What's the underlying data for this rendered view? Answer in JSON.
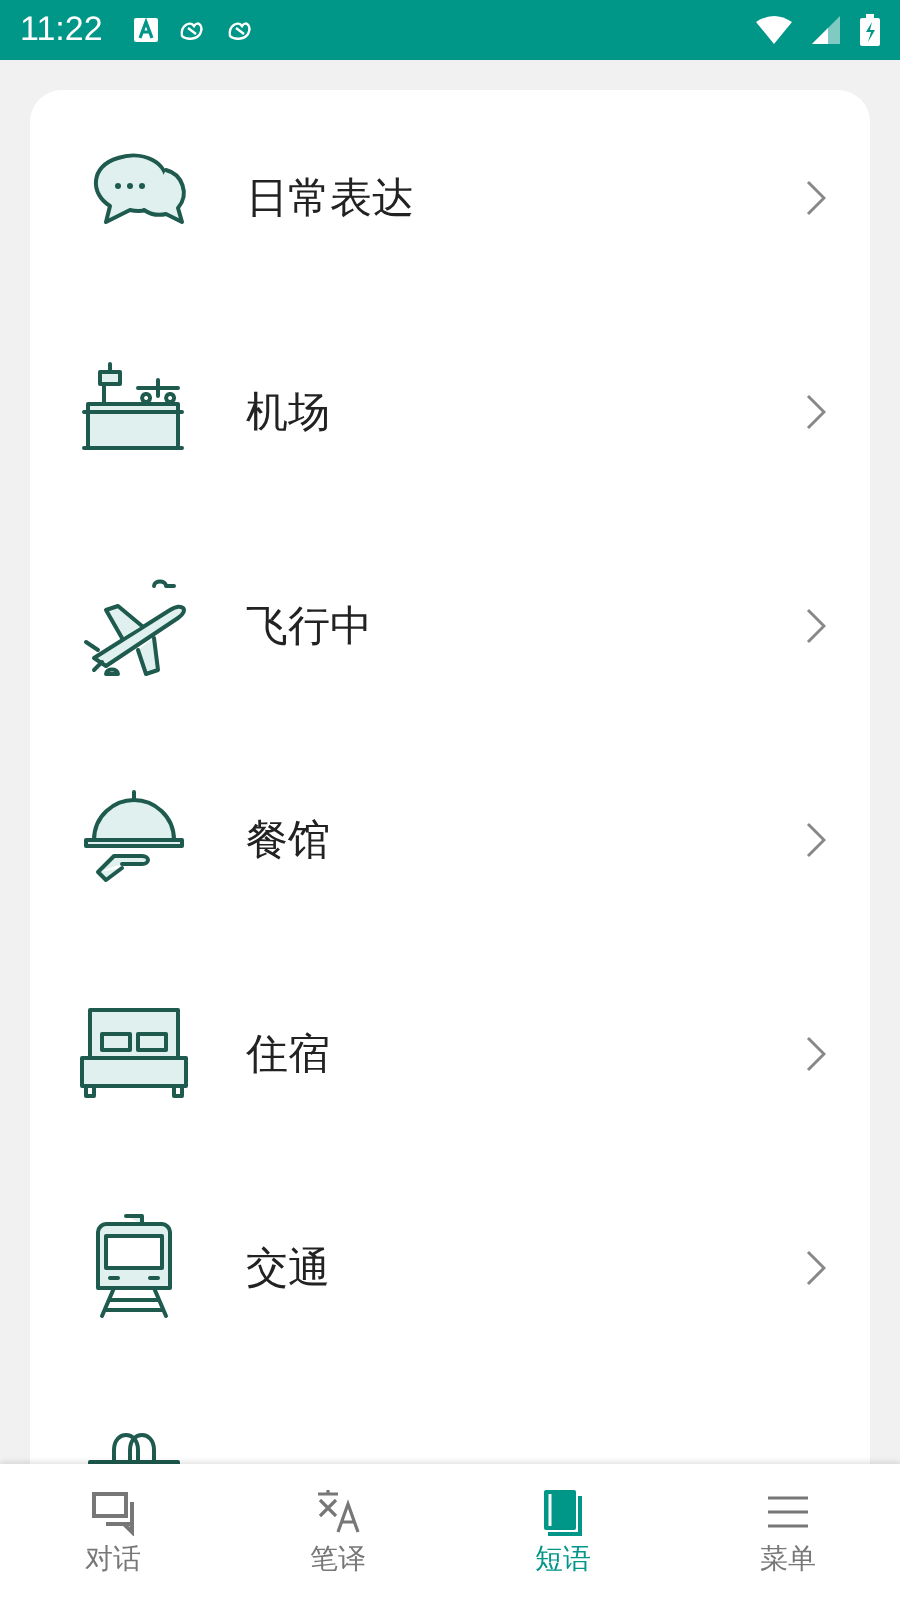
{
  "status_bar": {
    "time": "11:22"
  },
  "categories": [
    {
      "kind": "full",
      "label": "日常表达"
    },
    {
      "kind": "full",
      "label": "机场"
    },
    {
      "kind": "full",
      "label": "飞行中"
    },
    {
      "kind": "full",
      "label": "餐馆"
    },
    {
      "kind": "full",
      "label": "住宿"
    },
    {
      "kind": "full",
      "label": "交通"
    },
    {
      "kind": "cut-off"
    }
  ],
  "bottom_nav": [
    {
      "label": "对话",
      "selected": false
    },
    {
      "label": "笔译",
      "selected": false
    },
    {
      "label": "短语",
      "selected": true
    },
    {
      "label": "菜单",
      "selected": false
    }
  ]
}
